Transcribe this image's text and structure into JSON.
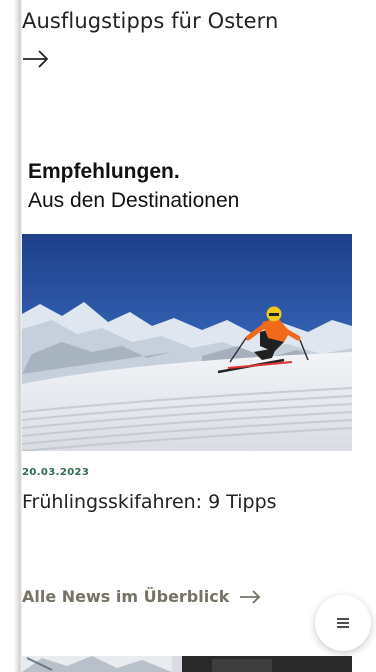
{
  "previous_teaser": {
    "title": "Ausflugstipps für Ostern",
    "arrow_icon": "arrow-right-icon"
  },
  "section": {
    "heading": "Empfehlungen.",
    "subheading": "Aus den Destinationen"
  },
  "news_card": {
    "image_icon": "skier-photo",
    "date": "20.03.2023",
    "title": "Frühlingsskifahren: 9 Tipps"
  },
  "all_news": {
    "label": "Alle News im Überblick",
    "arrow_icon": "arrow-right-icon"
  },
  "menu_button": {
    "icon": "menu-icon"
  },
  "colors": {
    "date_green": "#2f6b4e",
    "link_olive": "#767264",
    "text_dark": "#222222"
  }
}
